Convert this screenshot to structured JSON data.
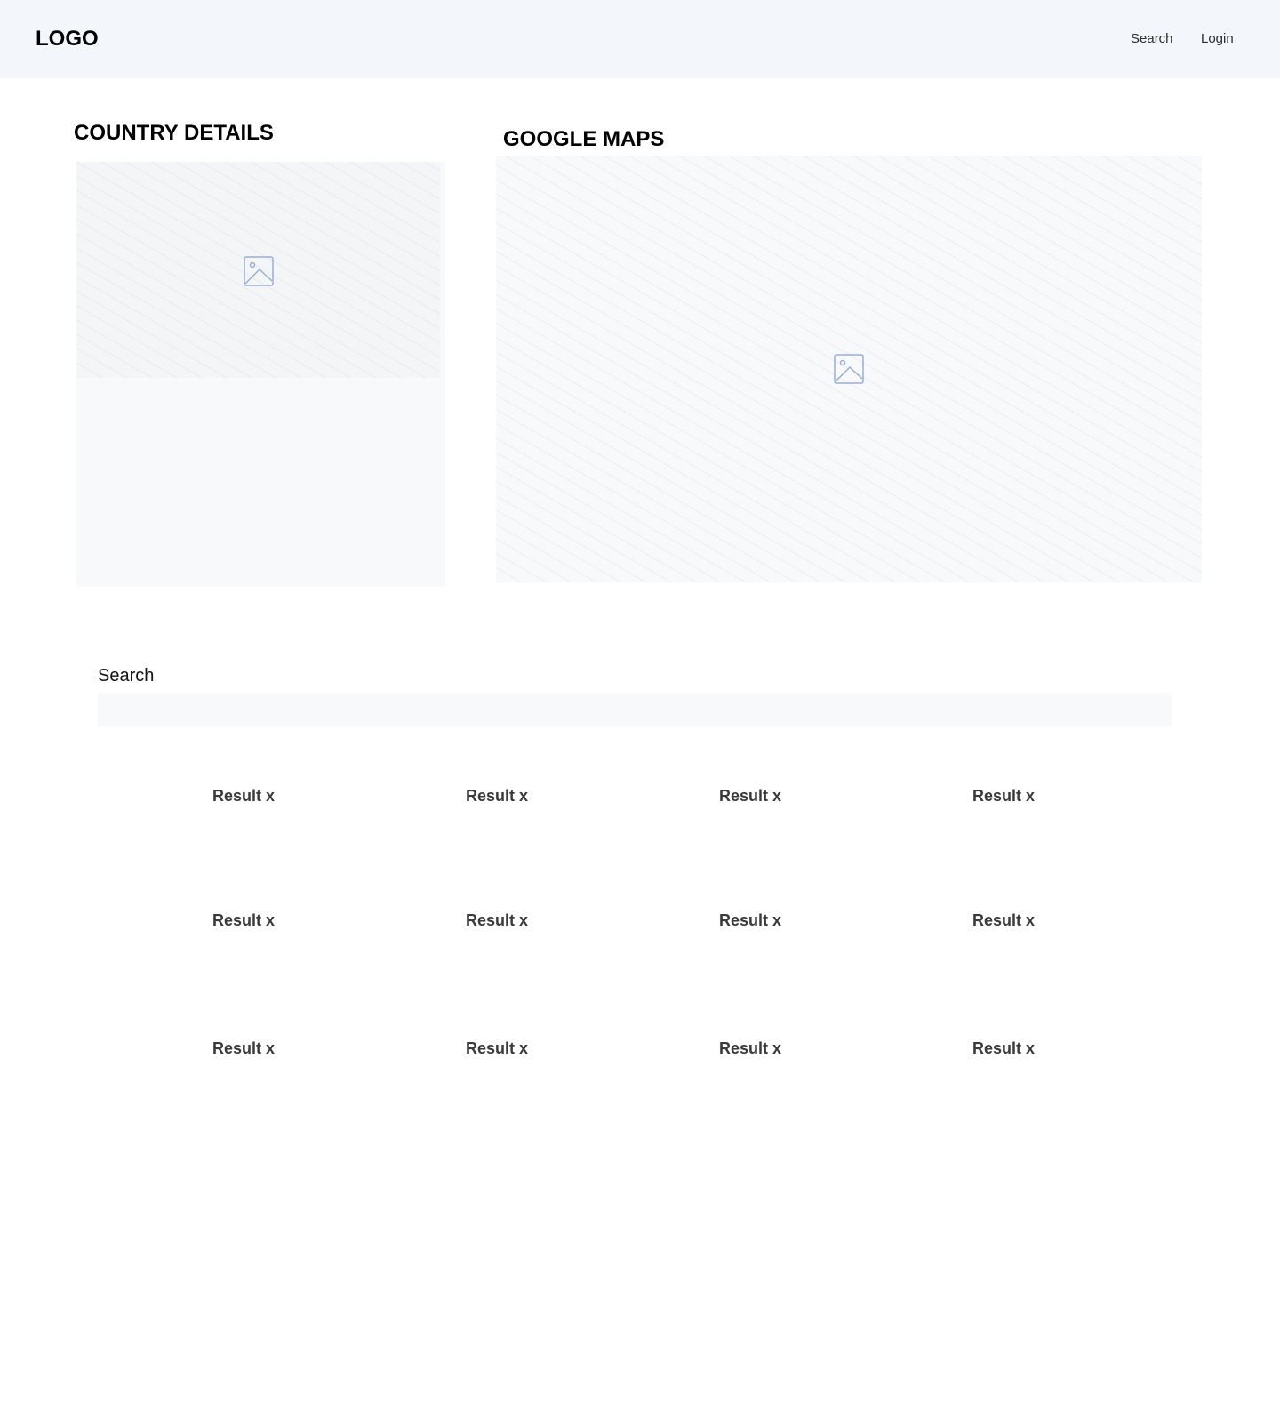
{
  "header": {
    "logo": "LOGO",
    "nav": {
      "search": "Search",
      "login": "Login"
    }
  },
  "country_details": {
    "title": "COUNTRY DETAILS",
    "image_icon": "image-placeholder-icon"
  },
  "google_maps": {
    "title": "GOOGLE MAPS",
    "image_icon": "image-placeholder-icon"
  },
  "search": {
    "label": "Search",
    "value": "",
    "placeholder": ""
  },
  "results": [
    [
      "Result x",
      "Result x",
      "Result x",
      "Result x"
    ],
    [
      "Result x",
      "Result x",
      "Result x",
      "Result x"
    ],
    [
      "Result x",
      "Result x",
      "Result x",
      "Result x"
    ]
  ],
  "colors": {
    "header_bg": "#f3f6fa",
    "placeholder_bg": "#f8f9fb",
    "icon": "#9aaed3"
  }
}
